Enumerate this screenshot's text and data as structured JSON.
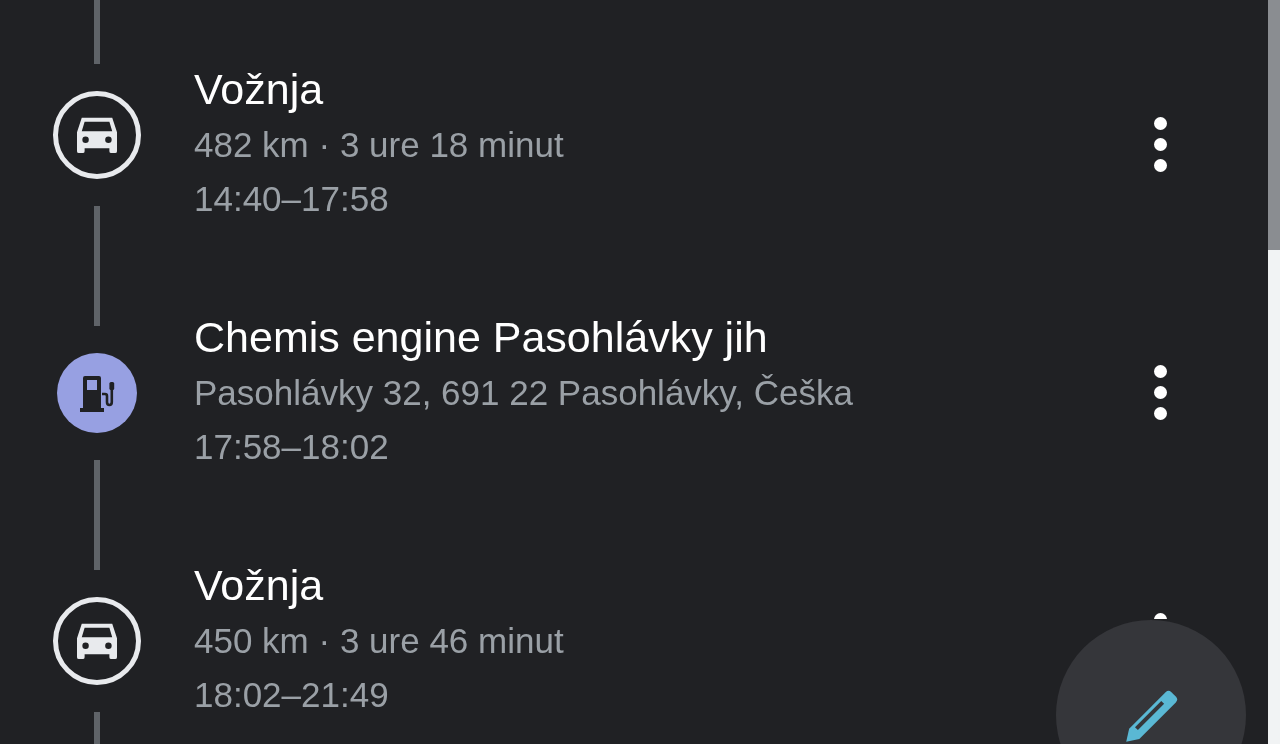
{
  "entries": [
    {
      "kind": "drive",
      "title": "Vožnja",
      "detail": "482 km · 3 ure 18 minut",
      "time": "14:40–17:58"
    },
    {
      "kind": "place",
      "title": "Chemis engine Pasohlávky jih",
      "detail": "Pasohlávky 32, 691 22 Pasohlávky, Češka",
      "time": "17:58–18:02"
    },
    {
      "kind": "drive",
      "title": "Vožnja",
      "detail": "450 km · 3 ure 46 minut",
      "time": "18:02–21:49"
    }
  ]
}
